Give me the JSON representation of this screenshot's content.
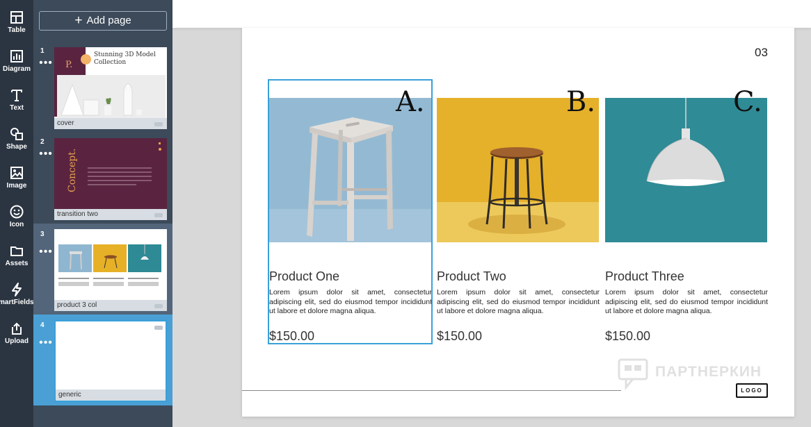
{
  "toolbar": {
    "items": [
      {
        "label": "Table",
        "icon": "table-icon"
      },
      {
        "label": "Diagram",
        "icon": "diagram-icon"
      },
      {
        "label": "Text",
        "icon": "text-icon"
      },
      {
        "label": "Shape",
        "icon": "shape-icon"
      },
      {
        "label": "Image",
        "icon": "image-icon"
      },
      {
        "label": "Icon",
        "icon": "smiley-icon"
      },
      {
        "label": "Assets",
        "icon": "folder-icon"
      },
      {
        "label": "SmartFields",
        "icon": "lightning-icon"
      },
      {
        "label": "Upload",
        "icon": "upload-icon"
      }
    ]
  },
  "pages_panel": {
    "add_page_label": "Add page",
    "pages": [
      {
        "number": "1",
        "label": "cover",
        "title": "Stunning 3D Model Collection",
        "mark": "P."
      },
      {
        "number": "2",
        "label": "transition two",
        "title": "Concept."
      },
      {
        "number": "3",
        "label": "product 3 col"
      },
      {
        "number": "4",
        "label": "generic"
      }
    ]
  },
  "slide": {
    "page_number": "03",
    "products": [
      {
        "letter": "A.",
        "name": "Product One",
        "description": "Lorem ipsum dolor sit amet, consectetur adipiscing elit, sed do eiusmod tempor incididunt ut labore et dolore magna aliqua.",
        "price": "$150.00"
      },
      {
        "letter": "B.",
        "name": "Product Two",
        "description": "Lorem ipsum dolor sit amet, consectetur adipiscing elit, sed do eiusmod tempor incididunt ut labore et dolore magna aliqua.",
        "price": "$150.00"
      },
      {
        "letter": "C.",
        "name": "Product Three",
        "description": "Lorem ipsum dolor sit amet, consectetur adipiscing elit, sed do eiusmod tempor incididunt ut labore et dolore magna aliqua.",
        "price": "$150.00"
      }
    ],
    "logo_text": "LOGO"
  },
  "watermark": {
    "text": "ПАРТНЕРКИН"
  },
  "colors": {
    "rail": "#2b3541",
    "panel": "#3c4a5a",
    "selection": "#39a0d8",
    "photo1_bg": "#8fb6d0",
    "photo2_bg": "#e6b127",
    "photo3_bg": "#2e8a95"
  }
}
